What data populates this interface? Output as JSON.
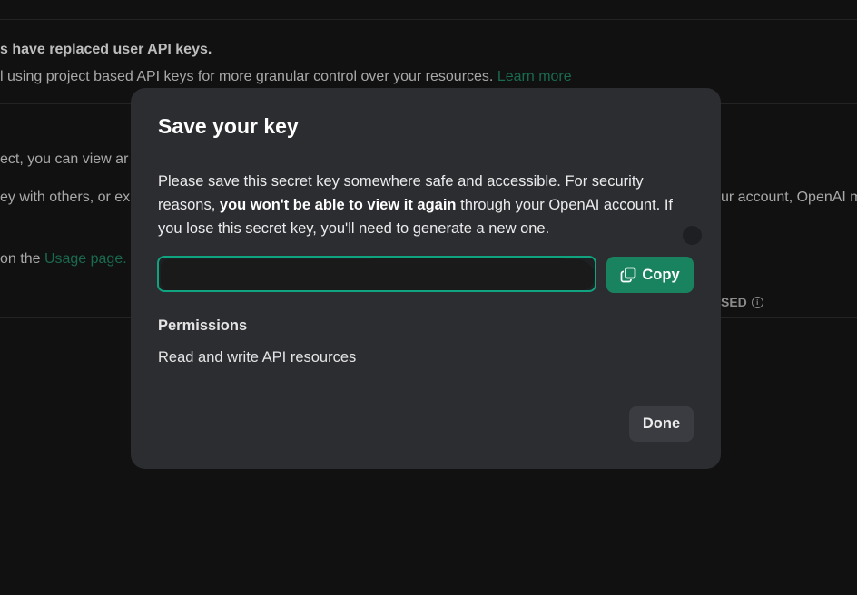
{
  "background": {
    "notice_title": "s have replaced user API keys.",
    "notice_body": "l using project based API keys for more granular control over your resources.",
    "notice_link": "Learn more",
    "line_1": "ect, you can view ar",
    "line_2_left": "ey with others, or ex",
    "line_2_right": "ur account, OpenAI m",
    "usage_prefix": "on the",
    "usage_link": "Usage page.",
    "column_header": "SED"
  },
  "modal": {
    "title": "Save your key",
    "desc_part1": "Please save this secret key somewhere safe and accessible. For security reasons,",
    "desc_bold": "you won't be able to view it again",
    "desc_part2": "through your OpenAI account. If you lose this secret key, you'll need to generate a new one.",
    "key_value": "",
    "copy_label": "Copy",
    "permissions_heading": "Permissions",
    "permissions_value": "Read and write API resources",
    "done_label": "Done"
  },
  "colors": {
    "accent": "#10a37f",
    "copy_button": "#19825f",
    "modal_bg": "#2c2d31",
    "page_bg": "#111111"
  },
  "icons": {
    "copy": "copy-icon",
    "info": "info-icon"
  }
}
